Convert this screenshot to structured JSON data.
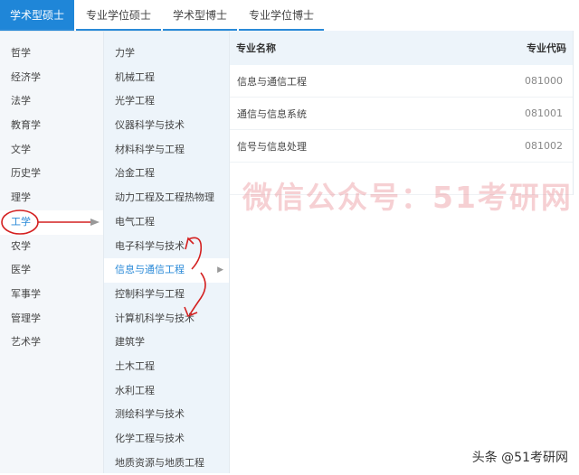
{
  "tabs": [
    "学术型硕士",
    "专业学位硕士",
    "学术型博士",
    "专业学位博士"
  ],
  "categories": [
    "哲学",
    "经济学",
    "法学",
    "教育学",
    "文学",
    "历史学",
    "理学",
    "工学",
    "农学",
    "医学",
    "军事学",
    "管理学",
    "艺术学"
  ],
  "selected_category": 7,
  "subjects": [
    "力学",
    "机械工程",
    "光学工程",
    "仪器科学与技术",
    "材料科学与工程",
    "冶金工程",
    "动力工程及工程热物理",
    "电气工程",
    "电子科学与技术",
    "信息与通信工程",
    "控制科学与工程",
    "计算机科学与技术",
    "建筑学",
    "土木工程",
    "水利工程",
    "测绘科学与技术",
    "化学工程与技术",
    "地质资源与地质工程"
  ],
  "selected_subject": 9,
  "table": {
    "headers": [
      "专业名称",
      "专业代码"
    ],
    "rows": [
      [
        "信息与通信工程",
        "081000"
      ],
      [
        "通信与信息系统",
        "081001"
      ],
      [
        "信号与信息处理",
        "081002"
      ]
    ]
  },
  "watermark": "微信公众号：51考研网",
  "footer": "头条 @51考研网",
  "colors": {
    "accent": "#1f86d8",
    "annotation": "#d42020"
  }
}
